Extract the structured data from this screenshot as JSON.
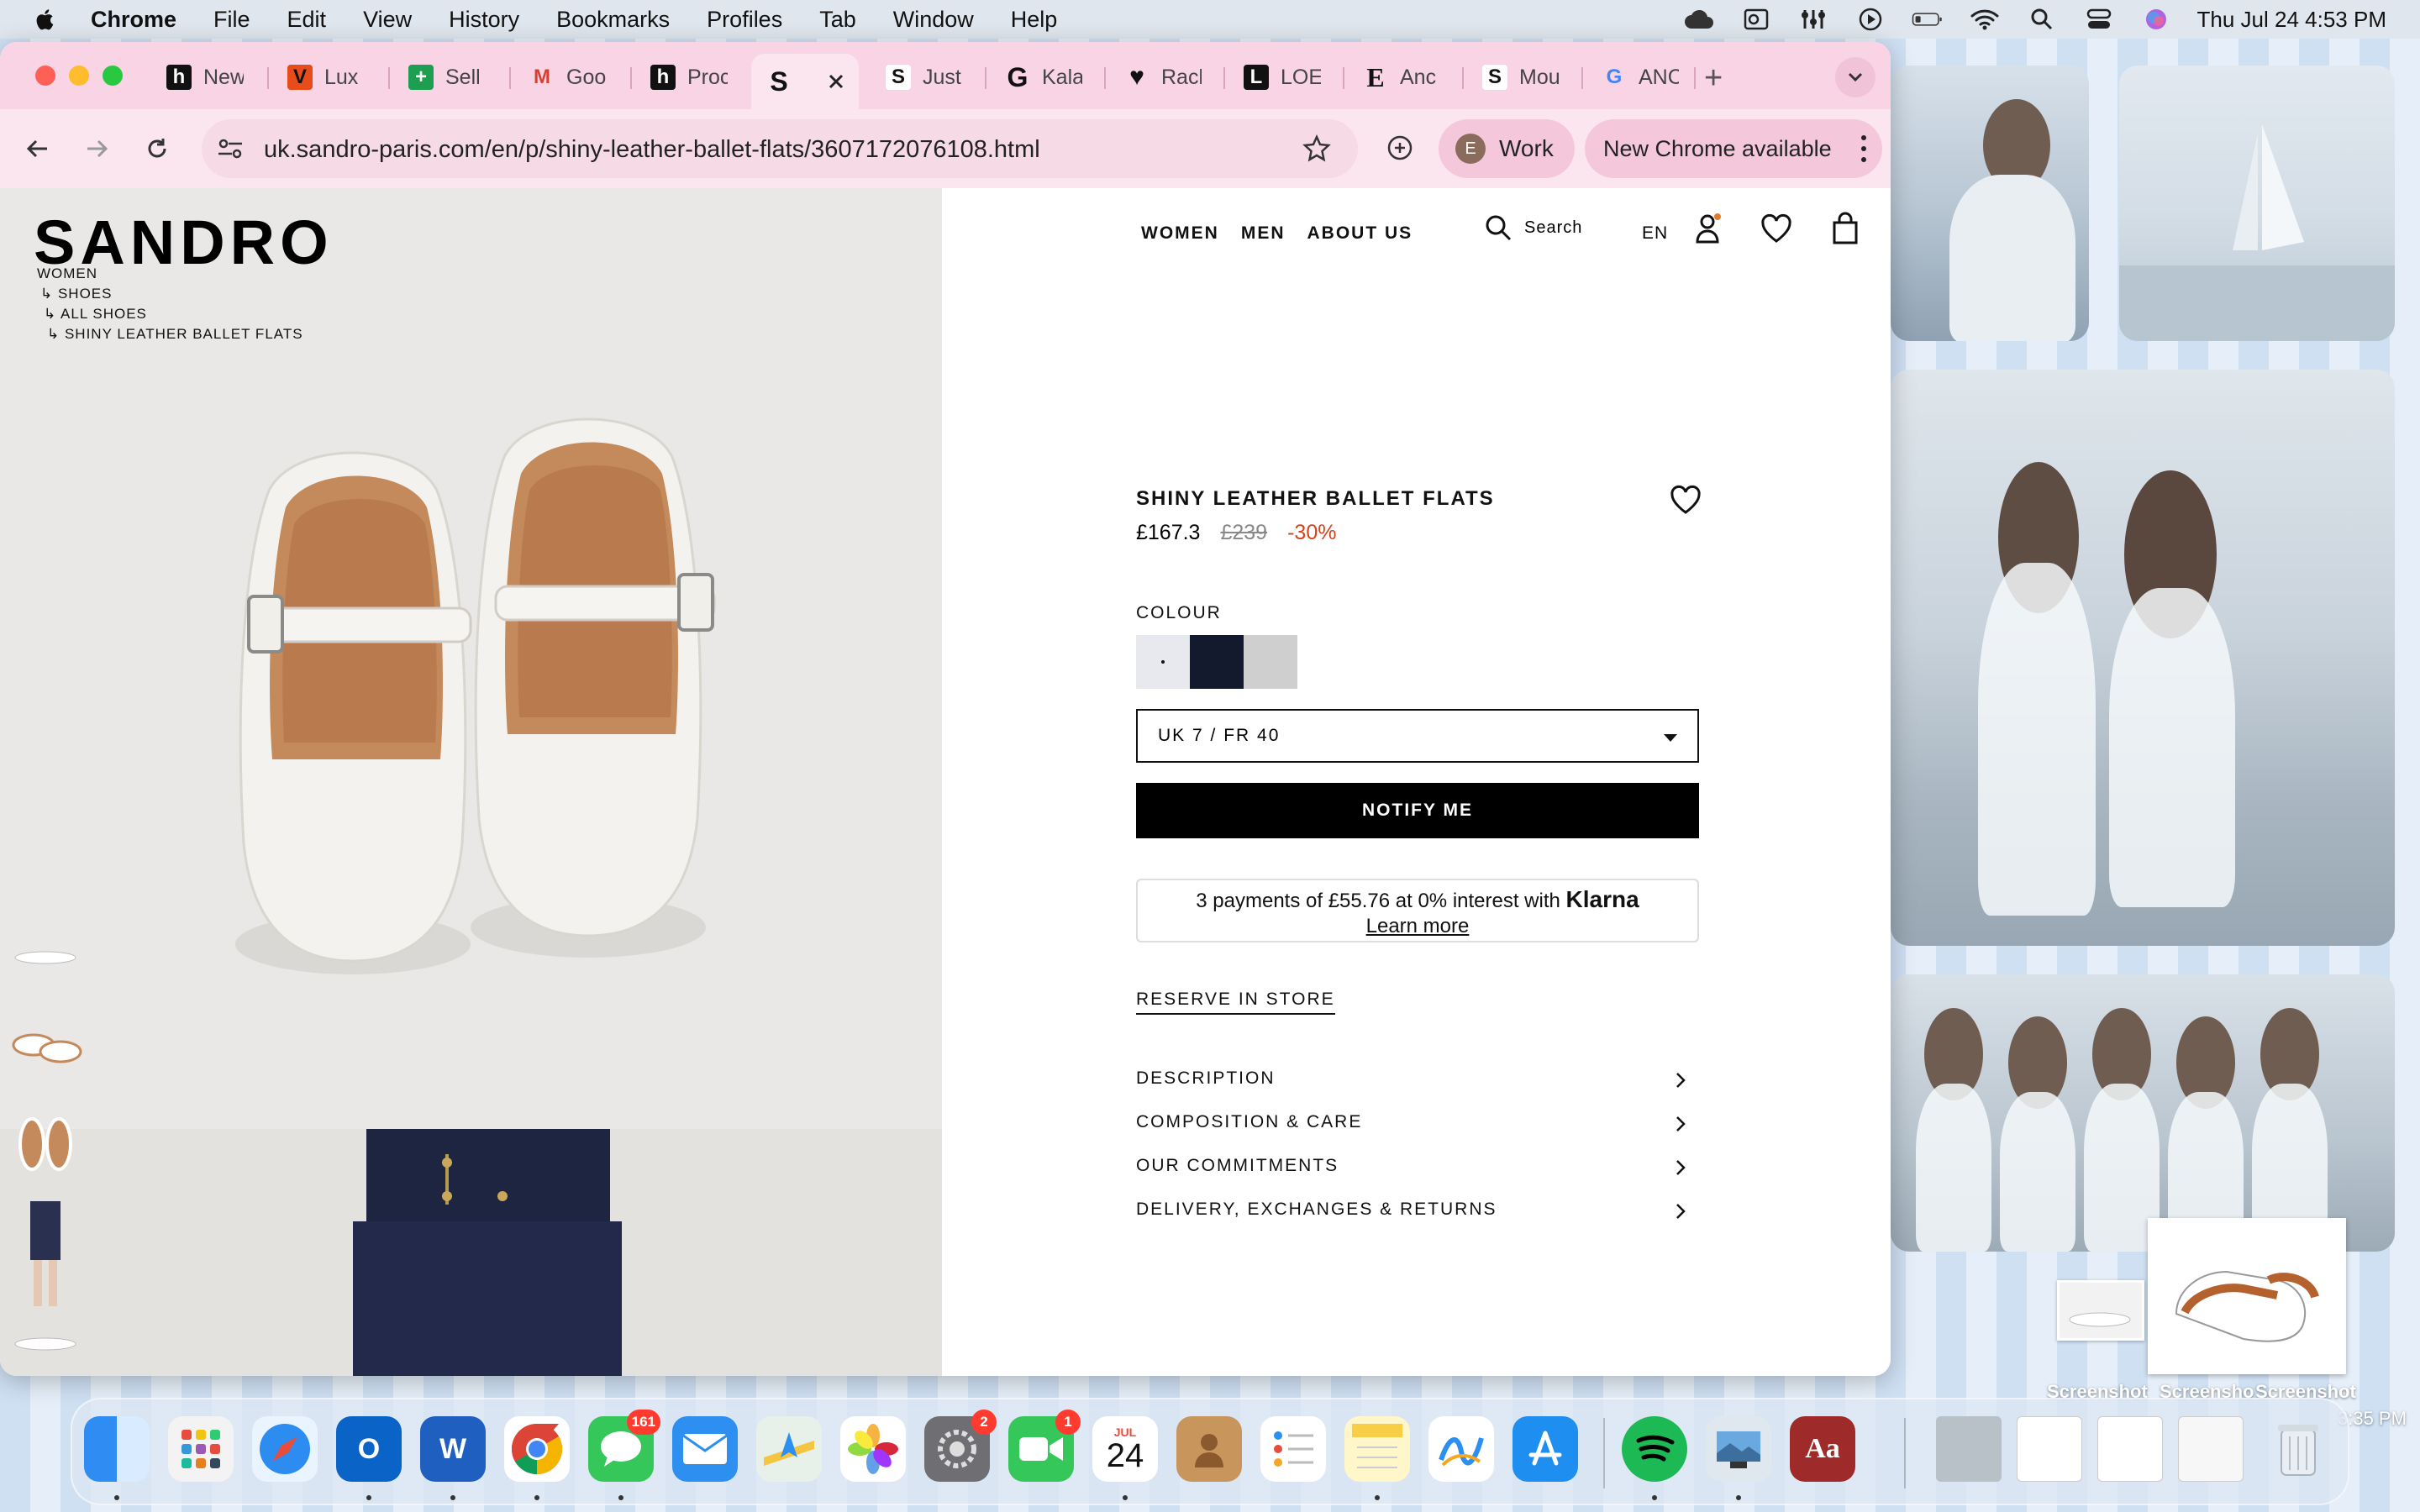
{
  "menubar": {
    "app": "Chrome",
    "items": [
      "File",
      "Edit",
      "View",
      "History",
      "Bookmarks",
      "Profiles",
      "Tab",
      "Window",
      "Help"
    ],
    "clock": "Thu Jul 24  4:53 PM"
  },
  "browser": {
    "tabs": [
      {
        "label": "New",
        "fav": "h",
        "color": "#111111"
      },
      {
        "label": "Lux",
        "fav": "V",
        "color": "#e84c1b"
      },
      {
        "label": "Sell",
        "fav": "+",
        "color": "#1e9e50"
      },
      {
        "label": "Goo",
        "fav": "M",
        "color": "#d64031"
      },
      {
        "label": "Proc",
        "fav": "h",
        "color": "#111111"
      },
      {
        "label": "S",
        "fav": "S",
        "color": "#111111",
        "active": true
      },
      {
        "label": "Just",
        "fav": "S",
        "color": "#111111"
      },
      {
        "label": "Kala",
        "fav": "G",
        "color": "#111111"
      },
      {
        "label": "Racl",
        "fav": "♥",
        "color": "#111111"
      },
      {
        "label": "LOE",
        "fav": "L",
        "color": "#111111"
      },
      {
        "label": "Anc",
        "fav": "E",
        "color": "#111111"
      },
      {
        "label": "Mou",
        "fav": "S",
        "color": "#111111"
      },
      {
        "label": "ANC",
        "fav": "G",
        "color": "#4285f4"
      }
    ],
    "url": "uk.sandro-paris.com/en/p/shiny-leather-ballet-flats/3607172076108.html",
    "profile_initial": "E",
    "profile_label": "Work",
    "update_label": "New Chrome available"
  },
  "site": {
    "logo": "SANDRO",
    "breadcrumb": [
      "WOMEN",
      "↳ SHOES",
      "↳ ALL SHOES",
      "↳ SHINY LEATHER BALLET FLATS"
    ],
    "nav": [
      "WOMEN",
      "MEN",
      "ABOUT US"
    ],
    "search_label": "Search",
    "lang": "EN"
  },
  "product": {
    "title": "SHINY LEATHER BALLET FLATS",
    "price": "£167.3",
    "price_old": "£239",
    "discount": "-30%",
    "colour_label": "COLOUR",
    "swatches": [
      "#e8e9ee",
      "#141a2e",
      "#cfcfcf"
    ],
    "size": "UK 7 / FR 40",
    "notify_label": "NOTIFY ME",
    "klarna_text": "3 payments of £55.76 at 0% interest with",
    "klarna_brand": "Klarna",
    "klarna_learn": "Learn more",
    "reserve_label": "RESERVE IN STORE",
    "accordion": [
      "DESCRIPTION",
      "COMPOSITION & CARE",
      "OUR COMMITMENTS",
      "DELIVERY, EXCHANGES & RETURNS"
    ]
  },
  "desktop": {
    "screenshot_labels": [
      "Screenshot",
      "Screensho",
      "Screenshot"
    ],
    "screenshot_time": "3:35 PM"
  },
  "dock": {
    "messages_badge": "161",
    "settings_badge": "2",
    "facetime_badge": "1",
    "calendar_month": "JUL",
    "calendar_day": "24"
  }
}
